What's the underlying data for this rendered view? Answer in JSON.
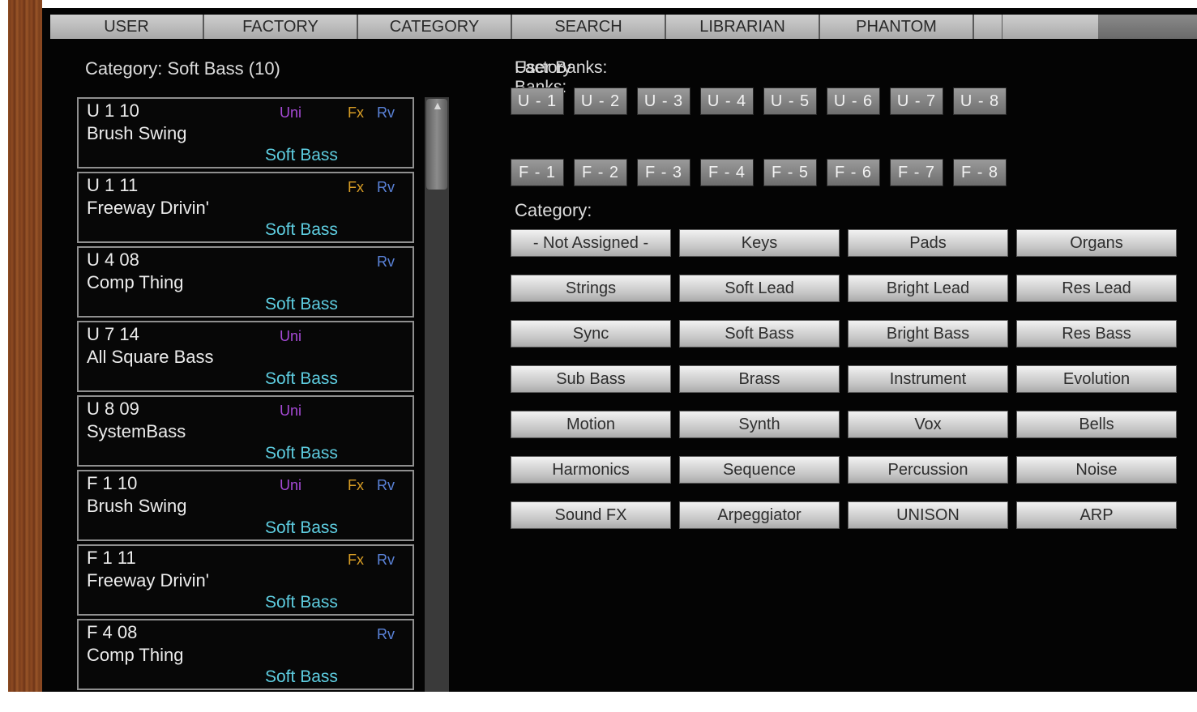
{
  "tabs": [
    "USER",
    "FACTORY",
    "CATEGORY",
    "SEARCH",
    "LIBRARIAN",
    "PHANTOM"
  ],
  "category_header": "Category: Soft Bass   (10)",
  "patches": [
    {
      "loc": "U 1 10",
      "name": "Brush Swing",
      "category": "Soft Bass",
      "uni": "Uni",
      "fx": "Fx",
      "rv": "Rv"
    },
    {
      "loc": "U 1 11",
      "name": "Freeway Drivin'",
      "category": "Soft Bass",
      "uni": "",
      "fx": "Fx",
      "rv": "Rv"
    },
    {
      "loc": "U 4 08",
      "name": "Comp Thing",
      "category": "Soft Bass",
      "uni": "",
      "fx": "",
      "rv": "Rv"
    },
    {
      "loc": "U 7 14",
      "name": "All Square Bass",
      "category": "Soft Bass",
      "uni": "Uni",
      "fx": "",
      "rv": ""
    },
    {
      "loc": "U 8 09",
      "name": "SystemBass",
      "category": "Soft Bass",
      "uni": "Uni",
      "fx": "",
      "rv": ""
    },
    {
      "loc": "F 1 10",
      "name": "Brush Swing",
      "category": "Soft Bass",
      "uni": "Uni",
      "fx": "Fx",
      "rv": "Rv"
    },
    {
      "loc": "F 1 11",
      "name": "Freeway Drivin'",
      "category": "Soft Bass",
      "uni": "",
      "fx": "Fx",
      "rv": "Rv"
    },
    {
      "loc": "F 4 08",
      "name": "Comp Thing",
      "category": "Soft Bass",
      "uni": "",
      "fx": "",
      "rv": "Rv"
    }
  ],
  "banks_label_a": "User Banks:",
  "banks_label_b": "Factory Banks:",
  "user_banks": [
    "U - 1",
    "U - 2",
    "U - 3",
    "U - 4",
    "U - 5",
    "U - 6",
    "U - 7",
    "U - 8"
  ],
  "factory_banks": [
    "F - 1",
    "F - 2",
    "F - 3",
    "F - 4",
    "F - 5",
    "F - 6",
    "F - 7",
    "F - 8"
  ],
  "category_label": "Category:",
  "categories": [
    "- Not Assigned -",
    "Keys",
    "Pads",
    "Organs",
    "Strings",
    "Soft Lead",
    "Bright Lead",
    "Res Lead",
    "Sync",
    "Soft Bass",
    "Bright Bass",
    "Res Bass",
    "Sub Bass",
    "Brass",
    "Instrument",
    "Evolution",
    "Motion",
    "Synth",
    "Vox",
    "Bells",
    "Harmonics",
    "Sequence",
    "Percussion",
    "Noise",
    "Sound FX",
    "Arpeggiator",
    "UNISON",
    "ARP"
  ],
  "colors": {
    "category_text": "#5ecde0",
    "uni": "#a64ad6",
    "fx": "#d89d25",
    "rv": "#5a82d8"
  }
}
